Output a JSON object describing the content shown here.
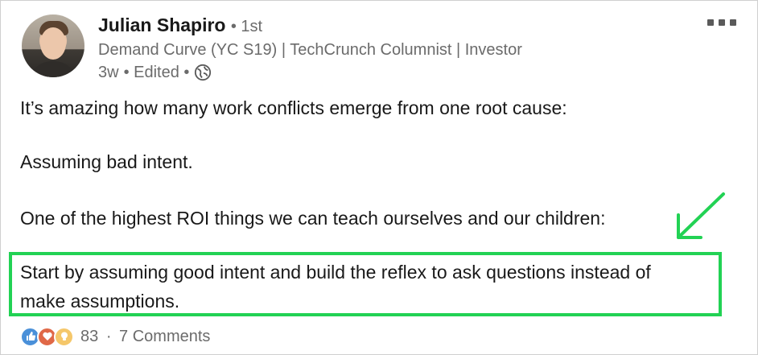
{
  "author": {
    "name": "Julian Shapiro",
    "degree": "• 1st",
    "headline": "Demand Curve (YC S19) | TechCrunch Columnist | Investor",
    "age": "3w",
    "edited": "• Edited •",
    "visibility_icon": "globe-icon",
    "avatar_icon": "avatar"
  },
  "post": {
    "paragraphs": [
      "It’s amazing how many work conflicts emerge from one root cause:",
      "Assuming bad intent.",
      "One of the highest ROI things we can teach ourselves and our children:",
      "Start by assuming good intent and build the reflex to ask questions instead of",
      "make assumptions."
    ]
  },
  "annotation": {
    "highlight_color": "#22d254",
    "arrow_icon": "arrow-icon"
  },
  "social": {
    "reaction_icons": [
      "like-icon",
      "love-icon",
      "insight-icon"
    ],
    "reaction_count": "83",
    "separator": "·",
    "comments": "7 Comments"
  },
  "colors": {
    "text": "#191919",
    "secondary": "#6b6b6b",
    "like": "#4a90d9",
    "love": "#e06847",
    "insight": "#f5c76a"
  }
}
